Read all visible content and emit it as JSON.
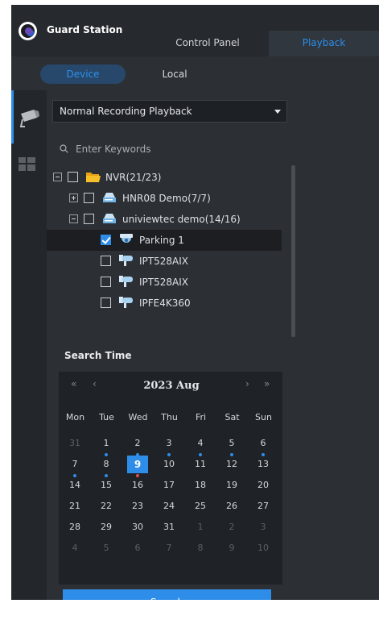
{
  "header": {
    "app_title": "Guard Station",
    "tabs": [
      {
        "label": "Control Panel",
        "active": false
      },
      {
        "label": "Playback",
        "active": true
      }
    ]
  },
  "subtabs": [
    {
      "label": "Device",
      "active": true
    },
    {
      "label": "Local",
      "active": false
    }
  ],
  "rail": {
    "items": [
      {
        "icon": "camera-icon",
        "active": true
      },
      {
        "icon": "grid-view-icon",
        "active": false
      }
    ]
  },
  "playback_mode": {
    "selected": "Normal Recording Playback"
  },
  "search": {
    "placeholder": "Enter Keywords",
    "value": ""
  },
  "tree": [
    {
      "label": "NVR(21/23)",
      "icon": "folder-icon",
      "expanded": true,
      "checked": false
    },
    {
      "label": "HNR08 Demo(7/7)",
      "icon": "nvr-device-icon",
      "expanded": false,
      "checked": false
    },
    {
      "label": "univiewtec demo(14/16)",
      "icon": "nvr-device-icon",
      "expanded": true,
      "checked": false
    },
    {
      "label": "Parking 1",
      "icon": "dome-camera-icon",
      "checked": true,
      "selected": true
    },
    {
      "label": "IPT528AIX",
      "icon": "bullet-camera-icon",
      "checked": false
    },
    {
      "label": "IPT528AIX",
      "icon": "bullet-camera-icon",
      "checked": false
    },
    {
      "label": "IPFE4K360",
      "icon": "bullet-camera-icon",
      "checked": false
    }
  ],
  "search_time": {
    "title": "Search Time",
    "calendar": {
      "nav": {
        "prev_year": "«",
        "prev_month": "‹",
        "next_month": "›",
        "next_year": "»"
      },
      "title": "2023 Aug",
      "weekdays": [
        "Mon",
        "Tue",
        "Wed",
        "Thu",
        "Fri",
        "Sat",
        "Sun"
      ],
      "weeks": [
        [
          "31",
          "1",
          "2",
          "3",
          "4",
          "5",
          "6"
        ],
        [
          "7",
          "8",
          "9",
          "10",
          "11",
          "12",
          "13"
        ],
        [
          "14",
          "15",
          "16",
          "17",
          "18",
          "19",
          "20"
        ],
        [
          "21",
          "22",
          "23",
          "24",
          "25",
          "26",
          "27"
        ],
        [
          "28",
          "29",
          "30",
          "31",
          "1",
          "2",
          "3"
        ],
        [
          "4",
          "5",
          "6",
          "7",
          "8",
          "9",
          "10"
        ]
      ],
      "muted_days": [
        [
          0,
          0
        ],
        [
          4,
          4
        ],
        [
          4,
          5
        ],
        [
          4,
          6
        ],
        [
          5,
          0
        ],
        [
          5,
          1
        ],
        [
          5,
          2
        ],
        [
          5,
          3
        ],
        [
          5,
          4
        ],
        [
          5,
          5
        ],
        [
          5,
          6
        ]
      ],
      "selected_day": [
        1,
        2
      ],
      "recording_markers": [
        {
          "cell": [
            0,
            1
          ],
          "color": "#2e8de8"
        },
        {
          "cell": [
            0,
            2
          ],
          "color": "#2e8de8"
        },
        {
          "cell": [
            0,
            3
          ],
          "color": "#2e8de8"
        },
        {
          "cell": [
            0,
            4
          ],
          "color": "#2e8de8"
        },
        {
          "cell": [
            0,
            5
          ],
          "color": "#2e8de8"
        },
        {
          "cell": [
            0,
            6
          ],
          "color": "#2e8de8"
        },
        {
          "cell": [
            1,
            0
          ],
          "color": "#2e8de8"
        },
        {
          "cell": [
            1,
            1
          ],
          "color": "#2e8de8"
        },
        {
          "cell": [
            1,
            2
          ],
          "color": "#e34a4a"
        }
      ]
    },
    "search_label": "Search"
  },
  "colors": {
    "accent": "#2e8de8",
    "alarm": "#e34a4a",
    "panel": "#2c2f33"
  }
}
